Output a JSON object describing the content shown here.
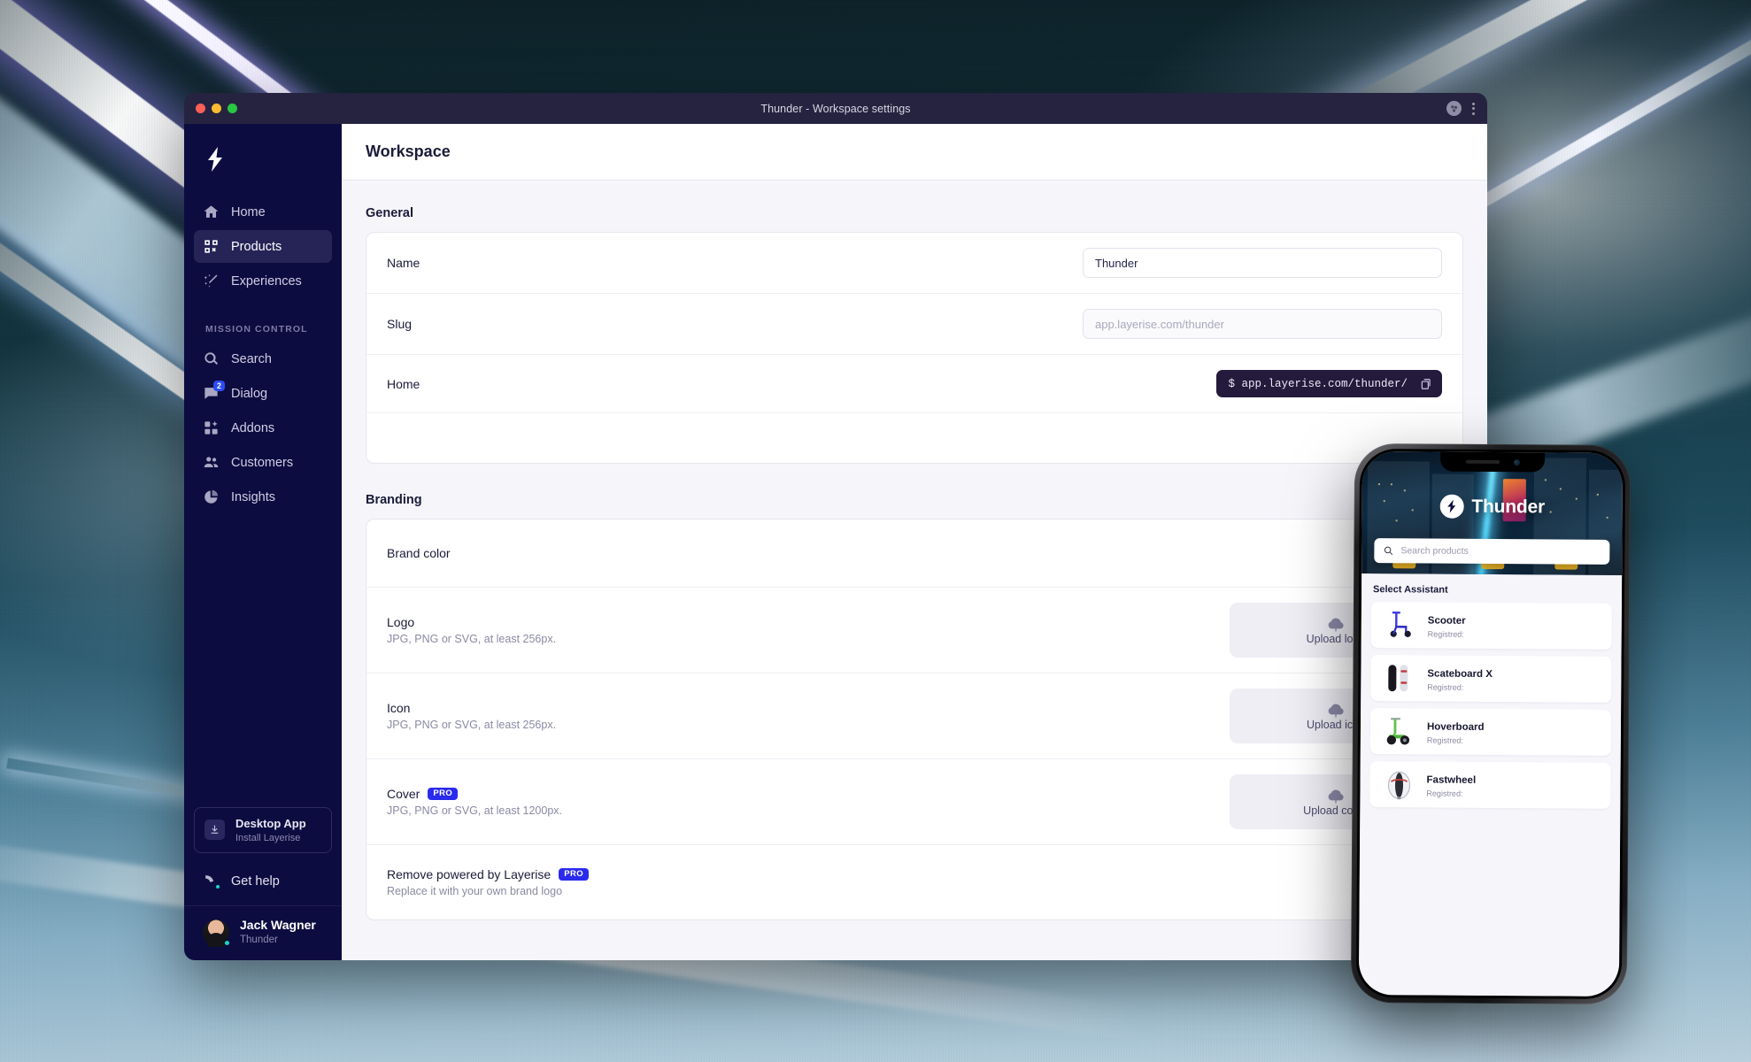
{
  "window": {
    "title": "Thunder - Workspace settings",
    "traffic_lights": [
      "close",
      "minimize",
      "maximize"
    ],
    "titlebar_icons": [
      "account-icon",
      "more-options-icon"
    ]
  },
  "sidebar": {
    "logo": "thunder-bolt-logo",
    "primary_items": [
      {
        "label": "Home",
        "icon": "home-icon",
        "active": false
      },
      {
        "label": "Products",
        "icon": "products-qr-icon",
        "active": true
      },
      {
        "label": "Experiences",
        "icon": "magic-wand-icon",
        "active": false
      }
    ],
    "section_label": "MISSION CONTROL",
    "mission_items": [
      {
        "label": "Search",
        "icon": "search-icon",
        "badge": ""
      },
      {
        "label": "Dialog",
        "icon": "chat-bubble-icon",
        "badge": "2"
      },
      {
        "label": "Addons",
        "icon": "addons-grid-icon",
        "badge": ""
      },
      {
        "label": "Customers",
        "icon": "customers-people-icon",
        "badge": ""
      },
      {
        "label": "Insights",
        "icon": "insights-pie-chart-icon",
        "badge": ""
      }
    ],
    "desktop_app": {
      "title": "Desktop App",
      "subtitle": "Install Layerise",
      "icon": "download-icon"
    },
    "get_help": {
      "label": "Get help",
      "icon": "support-icon"
    },
    "user": {
      "name": "Jack Wagner",
      "workspace": "Thunder",
      "avatar": "user-avatar"
    }
  },
  "page": {
    "title": "Workspace"
  },
  "general": {
    "heading": "General",
    "rows": [
      {
        "label": "Name",
        "value": "Thunder",
        "placeholder": "",
        "type": "input"
      },
      {
        "label": "Slug",
        "value": "",
        "placeholder": "app.layerise.com/thunder",
        "type": "input"
      },
      {
        "label": "Home",
        "value": "$ app.layerise.com/thunder/",
        "type": "code",
        "copy_icon": "copy-icon"
      }
    ]
  },
  "branding": {
    "heading": "Branding",
    "rows": [
      {
        "label": "Brand color",
        "sublabel": "",
        "badge": "",
        "type": "color",
        "color": "#2B2BEE"
      },
      {
        "label": "Logo",
        "sublabel": "JPG, PNG or SVG, at least 256px.",
        "badge": "",
        "type": "upload",
        "upload_label": "Upload logo",
        "upload_icon": "cloud-upload-icon"
      },
      {
        "label": "Icon",
        "sublabel": "JPG, PNG or SVG, at least 256px.",
        "badge": "",
        "type": "upload",
        "upload_label": "Upload icon",
        "upload_icon": "cloud-upload-icon"
      },
      {
        "label": "Cover",
        "sublabel": "JPG, PNG or SVG, at least 1200px.",
        "badge": "PRO",
        "type": "upload",
        "upload_label": "Upload cover",
        "upload_icon": "cloud-upload-icon"
      },
      {
        "label": "Remove powered by Layerise",
        "sublabel": "Replace it with your own brand logo",
        "badge": "PRO",
        "type": "toggle",
        "upload_label": "",
        "upload_icon": ""
      }
    ]
  },
  "phone": {
    "hero": {
      "brand": "Thunder",
      "logo_icon": "thunder-bolt-logo"
    },
    "search": {
      "placeholder": "Search products",
      "icon": "search-icon"
    },
    "list_heading": "Select Assistant",
    "products": [
      {
        "name": "Scooter",
        "meta": "Registred:",
        "thumb": "kick-scooter-image"
      },
      {
        "name": "Scateboard X",
        "meta": "Registred:",
        "thumb": "skateboard-image"
      },
      {
        "name": "Hoverboard",
        "meta": "Registred:",
        "thumb": "segway-hoverboard-image"
      },
      {
        "name": "Fastwheel",
        "meta": "Registred:",
        "thumb": "unicycle-wheel-image"
      }
    ]
  }
}
